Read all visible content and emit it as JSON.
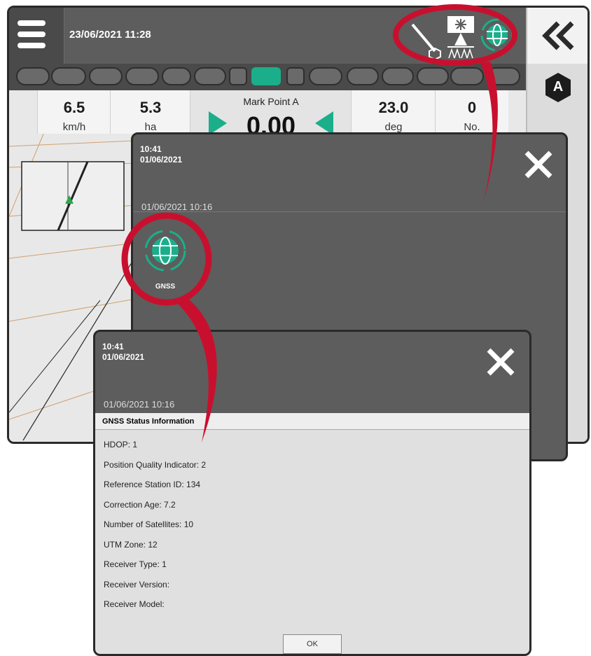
{
  "header": {
    "datetime": "23/06/2021 11:28"
  },
  "side": {
    "mode_letter": "A"
  },
  "sections": {
    "active_index": 7
  },
  "dashboard": {
    "speed_value": "6.5",
    "speed_unit": "km/h",
    "area_value": "5.3",
    "area_unit": "ha",
    "mark_label": "Mark Point A",
    "offset_value": "0.00",
    "heading_value": "23.0",
    "heading_unit": "deg",
    "count_value": "0",
    "count_unit": "No."
  },
  "notification_list": {
    "time": "10:41",
    "date": "01/06/2021",
    "entry_timestamp": "01/06/2021 10:16",
    "tile_label": "GNSS"
  },
  "gnss_dialog": {
    "time": "10:41",
    "date": "01/06/2021",
    "timestamp": "01/06/2021 10:16",
    "title": "GNSS Status Information",
    "lines": [
      "HDOP: 1",
      "Position Quality Indicator: 2",
      "Reference Station ID: 134",
      "Correction Age: 7.2",
      "Number of Satellites: 10",
      "UTM Zone: 12",
      "Receiver Type: 1",
      "Receiver Version:",
      "Receiver Model:"
    ],
    "ok_label": "OK"
  },
  "colors": {
    "accent_green": "#1aaf8a",
    "highlight_red": "#c8102e",
    "bar_dark": "#5d5d5d"
  },
  "icons": [
    "menu-icon",
    "boom-icon",
    "sprayer-icon",
    "gnss-icon",
    "double-chevron-left-icon",
    "guidance-mode-icon",
    "close-icon"
  ]
}
